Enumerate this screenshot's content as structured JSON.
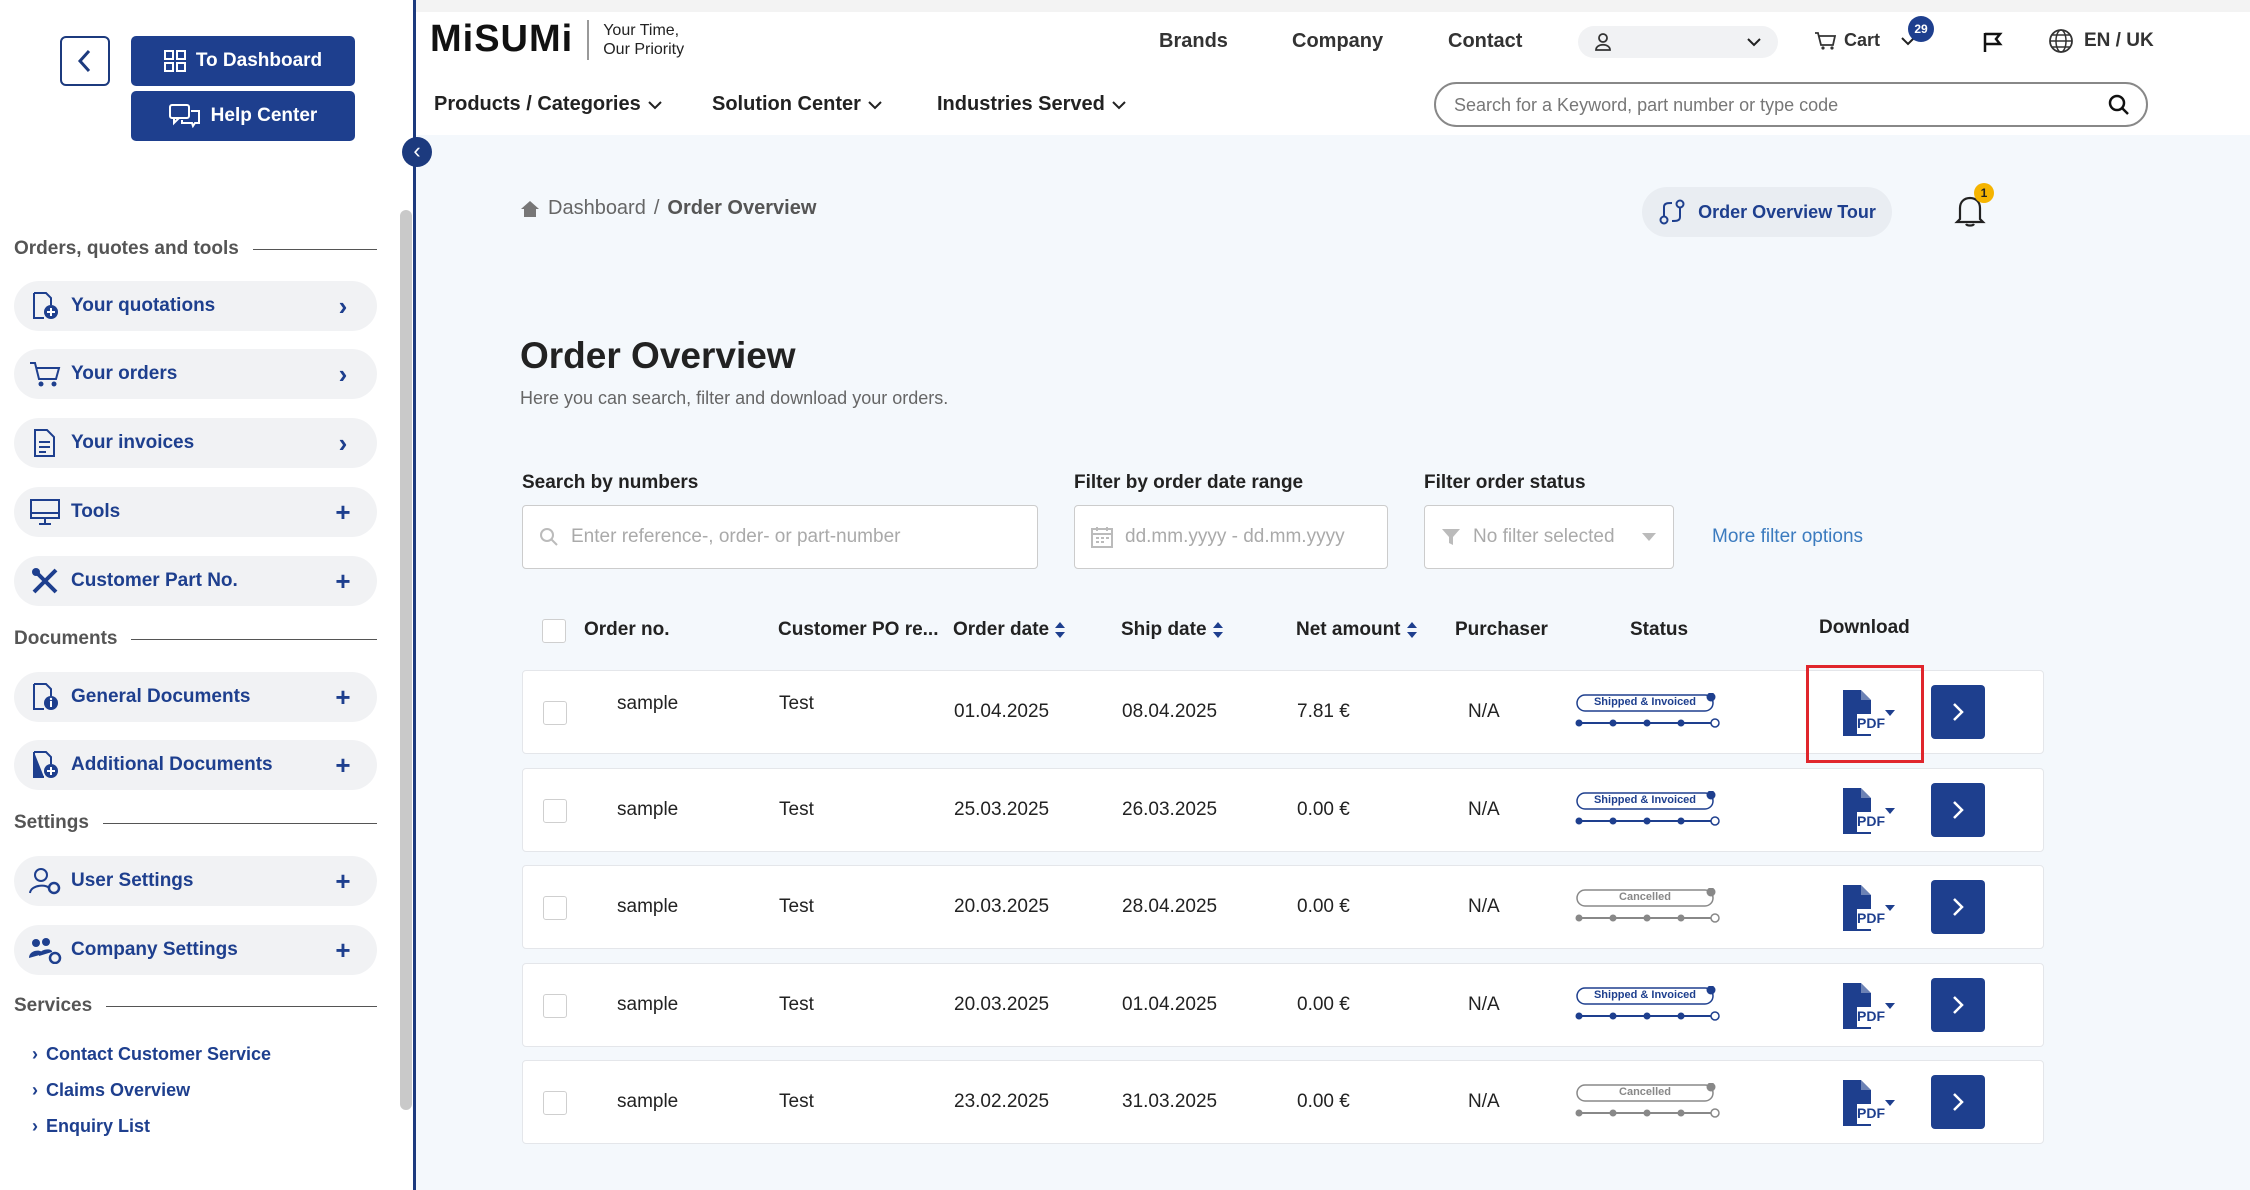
{
  "sidebar": {
    "to_dashboard": "To Dashboard",
    "help_center": "Help Center",
    "sections": {
      "orders": "Orders, quotes and tools",
      "documents": "Documents",
      "settings": "Settings",
      "services": "Services"
    },
    "items": {
      "quotations": "Your quotations",
      "orders": "Your orders",
      "invoices": "Your invoices",
      "tools": "Tools",
      "customer_part": "Customer Part No.",
      "general_docs": "General Documents",
      "additional_docs": "Additional Documents",
      "user_settings": "User Settings",
      "company_settings": "Company Settings"
    },
    "services": [
      "Contact Customer Service",
      "Claims Overview",
      "Enquiry List"
    ]
  },
  "header": {
    "logo": "MiSUMi",
    "tagline_1": "Your Time,",
    "tagline_2": "Our Priority",
    "nav": [
      "Brands",
      "Company",
      "Contact"
    ],
    "cart": "Cart",
    "cart_count": "29",
    "language": "EN / UK",
    "menu": [
      "Products / Categories",
      "Solution Center",
      "Industries Served"
    ],
    "search_placeholder": "Search for a Keyword, part number or type code"
  },
  "main": {
    "breadcrumb_home": "Dashboard",
    "breadcrumb_sep": "/",
    "breadcrumb_current": "Order Overview",
    "tour_button": "Order Overview Tour",
    "notification_count": "1",
    "title": "Order Overview",
    "subtitle": "Here you can search, filter and download your orders.",
    "filters": {
      "search_label": "Search by numbers",
      "search_placeholder": "Enter reference-, order- or part-number",
      "date_label": "Filter by order date range",
      "date_placeholder": "dd.mm.yyyy - dd.mm.yyyy",
      "status_label": "Filter order status",
      "status_placeholder": "No filter selected",
      "more": "More filter options"
    },
    "columns": [
      "Order no.",
      "Customer PO re...",
      "Order date",
      "Ship date",
      "Net amount",
      "Purchaser",
      "Status",
      "Download"
    ],
    "rows": [
      {
        "order_no": "sample",
        "po": "Test",
        "order_date": "01.04.2025",
        "ship_date": "08.04.2025",
        "amount": "7.81 €",
        "purchaser": "N/A",
        "status": "Shipped & Invoiced",
        "status_progress": 4
      },
      {
        "order_no": "sample",
        "po": "Test",
        "order_date": "25.03.2025",
        "ship_date": "26.03.2025",
        "amount": "0.00 €",
        "purchaser": "N/A",
        "status": "Shipped & Invoiced",
        "status_progress": 4
      },
      {
        "order_no": "sample",
        "po": "Test",
        "order_date": "20.03.2025",
        "ship_date": "28.04.2025",
        "amount": "0.00 €",
        "purchaser": "N/A",
        "status": "Cancelled",
        "status_progress": 0
      },
      {
        "order_no": "sample",
        "po": "Test",
        "order_date": "20.03.2025",
        "ship_date": "01.04.2025",
        "amount": "0.00 €",
        "purchaser": "N/A",
        "status": "Shipped & Invoiced",
        "status_progress": 4
      },
      {
        "order_no": "sample",
        "po": "Test",
        "order_date": "23.02.2025",
        "ship_date": "31.03.2025",
        "amount": "0.00 €",
        "purchaser": "N/A",
        "status": "Cancelled",
        "status_progress": 0
      }
    ],
    "pdf_label": "PDF"
  },
  "colors": {
    "brand_blue": "#1e3f8e",
    "highlight": "#e0262c",
    "badge": "#f5b400"
  }
}
